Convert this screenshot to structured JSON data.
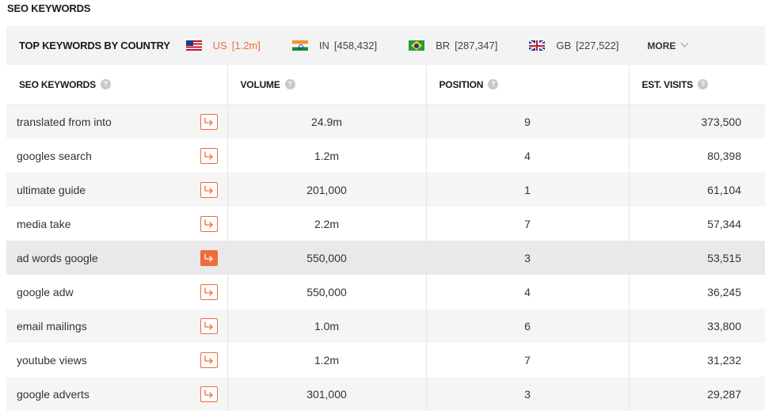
{
  "section_title": "SEO KEYWORDS",
  "country_bar": {
    "title": "TOP KEYWORDS BY COUNTRY",
    "countries": [
      {
        "flag": "us-flag",
        "code": "US",
        "count": "[1.2m]",
        "active": true
      },
      {
        "flag": "in-flag",
        "code": "IN",
        "count": "[458,432]",
        "active": false
      },
      {
        "flag": "br-flag",
        "code": "BR",
        "count": "[287,347]",
        "active": false
      },
      {
        "flag": "gb-flag",
        "code": "GB",
        "count": "[227,522]",
        "active": false
      }
    ],
    "more_label": "MORE",
    "accent_color": "#f06b3c"
  },
  "table": {
    "headers": [
      "SEO KEYWORDS",
      "VOLUME",
      "POSITION",
      "EST. VISITS"
    ],
    "help_glyph": "?",
    "rows": [
      {
        "keyword": "translated from into",
        "volume": "24.9m",
        "position": "9",
        "visits": "373,500"
      },
      {
        "keyword": "googles search",
        "volume": "1.2m",
        "position": "4",
        "visits": "80,398"
      },
      {
        "keyword": "ultimate guide",
        "volume": "201,000",
        "position": "1",
        "visits": "61,104"
      },
      {
        "keyword": "media take",
        "volume": "2.2m",
        "position": "7",
        "visits": "57,344"
      },
      {
        "keyword": "ad words google",
        "volume": "550,000",
        "position": "3",
        "visits": "53,515",
        "highlighted": true
      },
      {
        "keyword": "google adw",
        "volume": "550,000",
        "position": "4",
        "visits": "36,245"
      },
      {
        "keyword": "email mailings",
        "volume": "1.0m",
        "position": "6",
        "visits": "33,800"
      },
      {
        "keyword": "youtube views",
        "volume": "1.2m",
        "position": "7",
        "visits": "31,232"
      },
      {
        "keyword": "google adverts",
        "volume": "301,000",
        "position": "3",
        "visits": "29,287"
      }
    ]
  }
}
